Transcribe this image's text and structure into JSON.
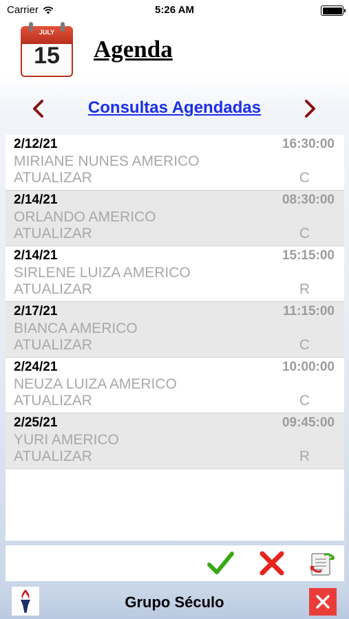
{
  "status_bar": {
    "carrier": "Carrier",
    "time": "5:26 AM"
  },
  "header": {
    "title": "Agenda",
    "calendar_month": "JULY",
    "calendar_day": "15"
  },
  "nav": {
    "title": "Consultas Agendadas"
  },
  "appointments": [
    {
      "date": "2/12/21",
      "time": "16:30:00",
      "name": "MIRIANE NUNES AMERICO",
      "action": "ATUALIZAR",
      "status": "C"
    },
    {
      "date": "2/14/21",
      "time": "08:30:00",
      "name": "ORLANDO AMERICO",
      "action": "ATUALIZAR",
      "status": "C"
    },
    {
      "date": "2/14/21",
      "time": "15:15:00",
      "name": "SIRLENE LUIZA AMERICO",
      "action": "ATUALIZAR",
      "status": "R"
    },
    {
      "date": "2/17/21",
      "time": "11:15:00",
      "name": "BIANCA AMERICO",
      "action": "ATUALIZAR",
      "status": "C"
    },
    {
      "date": "2/24/21",
      "time": "10:00:00",
      "name": "NEUZA LUIZA AMERICO",
      "action": "ATUALIZAR",
      "status": "C"
    },
    {
      "date": "2/25/21",
      "time": "09:45:00",
      "name": "YURI AMERICO",
      "action": "ATUALIZAR",
      "status": "R"
    }
  ],
  "toolbar": {
    "confirm_icon": "checkmark-icon",
    "cancel_icon": "x-mark-icon",
    "refresh_icon": "refresh-document-icon"
  },
  "footer": {
    "title": "Grupo Século"
  },
  "colors": {
    "nav_link": "#1a2ee6",
    "nav_arrow": "#8b1010",
    "confirm": "#3aa814",
    "cancel": "#e8231e",
    "close_bg": "#ea3d3a"
  }
}
